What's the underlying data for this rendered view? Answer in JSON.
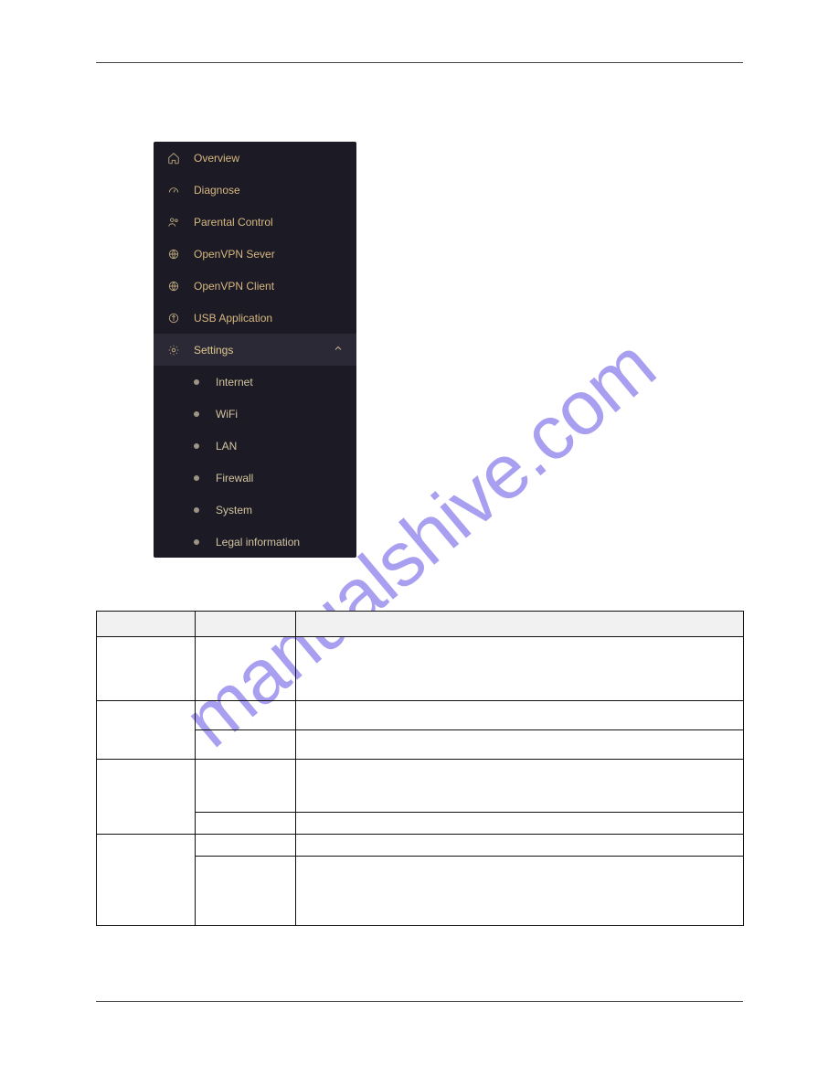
{
  "watermark": "manualshive.com",
  "sidebar": {
    "items": [
      {
        "label": "Overview",
        "icon": "home-icon"
      },
      {
        "label": "Diagnose",
        "icon": "gauge-icon"
      },
      {
        "label": "Parental Control",
        "icon": "people-icon"
      },
      {
        "label": "OpenVPN Sever",
        "icon": "globe-icon"
      },
      {
        "label": "OpenVPN Client",
        "icon": "globe-icon"
      },
      {
        "label": "USB Application",
        "icon": "usb-icon"
      },
      {
        "label": "Settings",
        "icon": "gear-icon",
        "expanded": true
      }
    ],
    "settings_children": [
      {
        "label": "Internet"
      },
      {
        "label": "WiFi"
      },
      {
        "label": "LAN"
      },
      {
        "label": "Firewall"
      },
      {
        "label": "System"
      },
      {
        "label": "Legal information"
      }
    ]
  },
  "table": {
    "headers": [
      "",
      "",
      ""
    ],
    "rows": [
      {
        "c1": "",
        "c2": "",
        "c3": "",
        "c1_rowspan": 1
      },
      {
        "c1": "",
        "c2a": "",
        "c3a": "",
        "c2b": "",
        "c3b": ""
      },
      {
        "c1": "",
        "c2a": "",
        "c3a": "",
        "c2b": "",
        "c3b": ""
      },
      {
        "c1": "",
        "c2a": "",
        "c3a": "",
        "c2b": "",
        "c3b": ""
      }
    ]
  }
}
